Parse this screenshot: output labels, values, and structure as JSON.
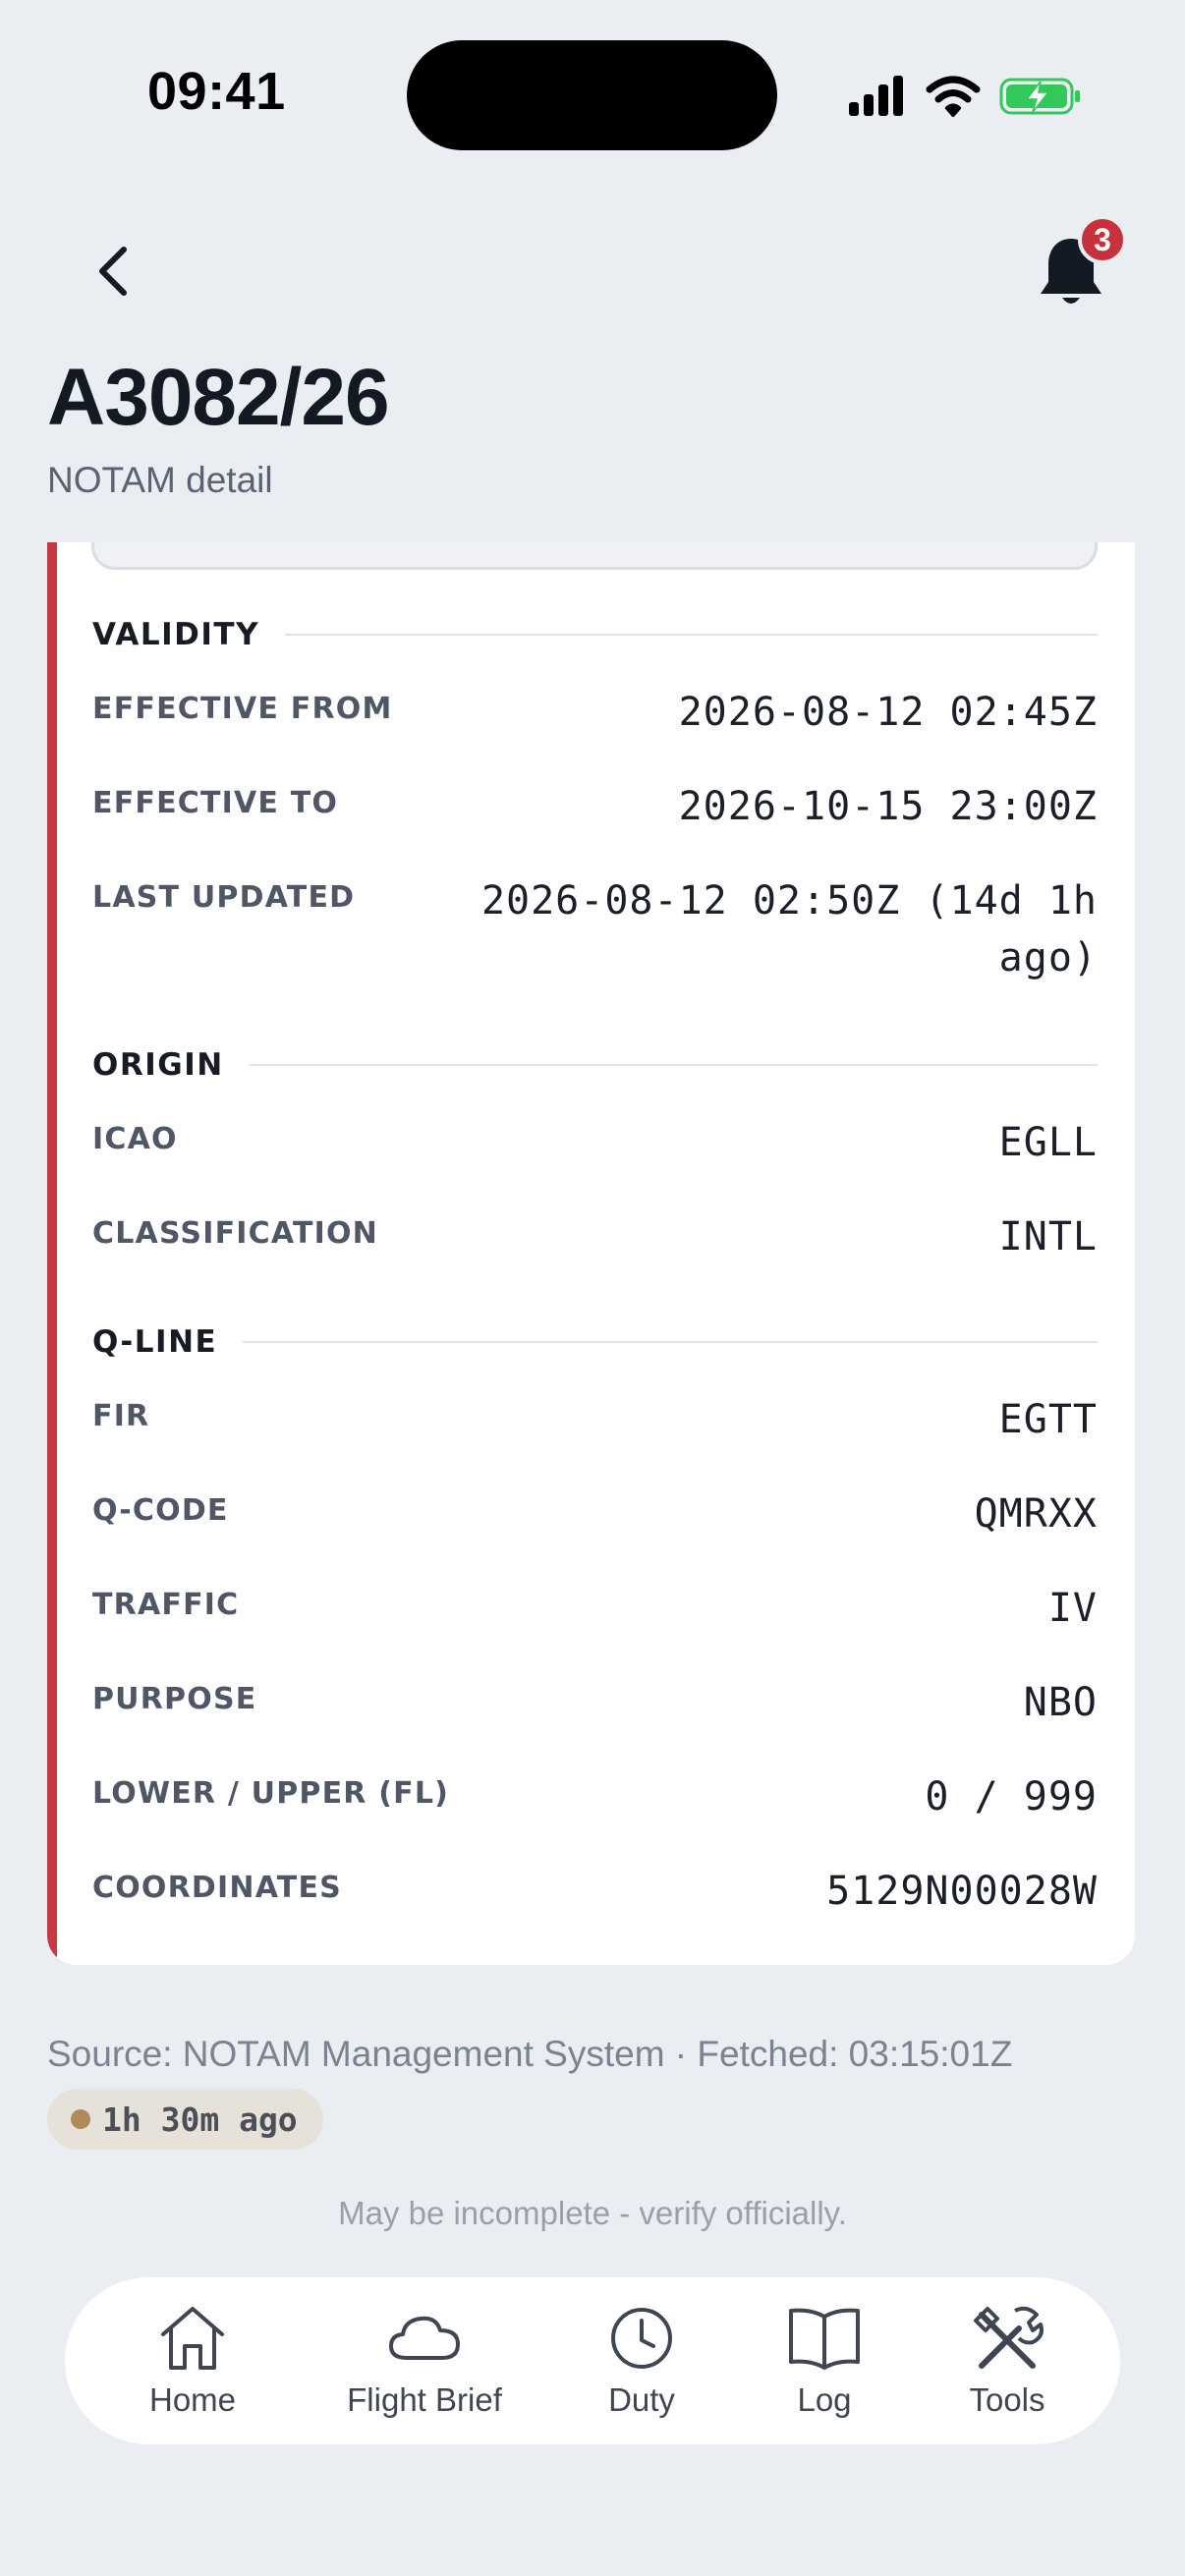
{
  "status_bar": {
    "time": "09:41"
  },
  "header": {
    "notification_count": "3",
    "title": "A3082/26",
    "subtitle": "NOTAM detail"
  },
  "sections": {
    "validity": {
      "title": "VALIDITY",
      "rows": [
        {
          "label": "EFFECTIVE FROM",
          "value": "2026-08-12 02:45Z"
        },
        {
          "label": "EFFECTIVE TO",
          "value": "2026-10-15 23:00Z"
        },
        {
          "label": "LAST UPDATED",
          "value": "2026-08-12 02:50Z (14d 1h ago)"
        }
      ]
    },
    "origin": {
      "title": "ORIGIN",
      "rows": [
        {
          "label": "ICAO",
          "value": "EGLL"
        },
        {
          "label": "CLASSIFICATION",
          "value": "INTL"
        }
      ]
    },
    "qline": {
      "title": "Q-LINE",
      "rows": [
        {
          "label": "FIR",
          "value": "EGTT"
        },
        {
          "label": "Q-CODE",
          "value": "QMRXX"
        },
        {
          "label": "TRAFFIC",
          "value": "IV"
        },
        {
          "label": "PURPOSE",
          "value": "NBO"
        },
        {
          "label": "LOWER / UPPER (FL)",
          "value": "0 / 999"
        },
        {
          "label": "COORDINATES",
          "value": "5129N00028W"
        }
      ]
    }
  },
  "footer": {
    "source": "Source: NOTAM Management System · Fetched: 03:15:01Z",
    "age": "1h 30m ago",
    "disclaimer": "May be incomplete - verify officially."
  },
  "tabs": [
    {
      "label": "Home",
      "icon": "home-icon"
    },
    {
      "label": "Flight Brief",
      "icon": "cloud-icon"
    },
    {
      "label": "Duty",
      "icon": "clock-icon"
    },
    {
      "label": "Log",
      "icon": "book-icon"
    },
    {
      "label": "Tools",
      "icon": "tools-icon"
    }
  ],
  "colors": {
    "accent": "#c63a45",
    "badge": "#c6313c",
    "background": "#eaedf2",
    "battery": "#34c759"
  }
}
